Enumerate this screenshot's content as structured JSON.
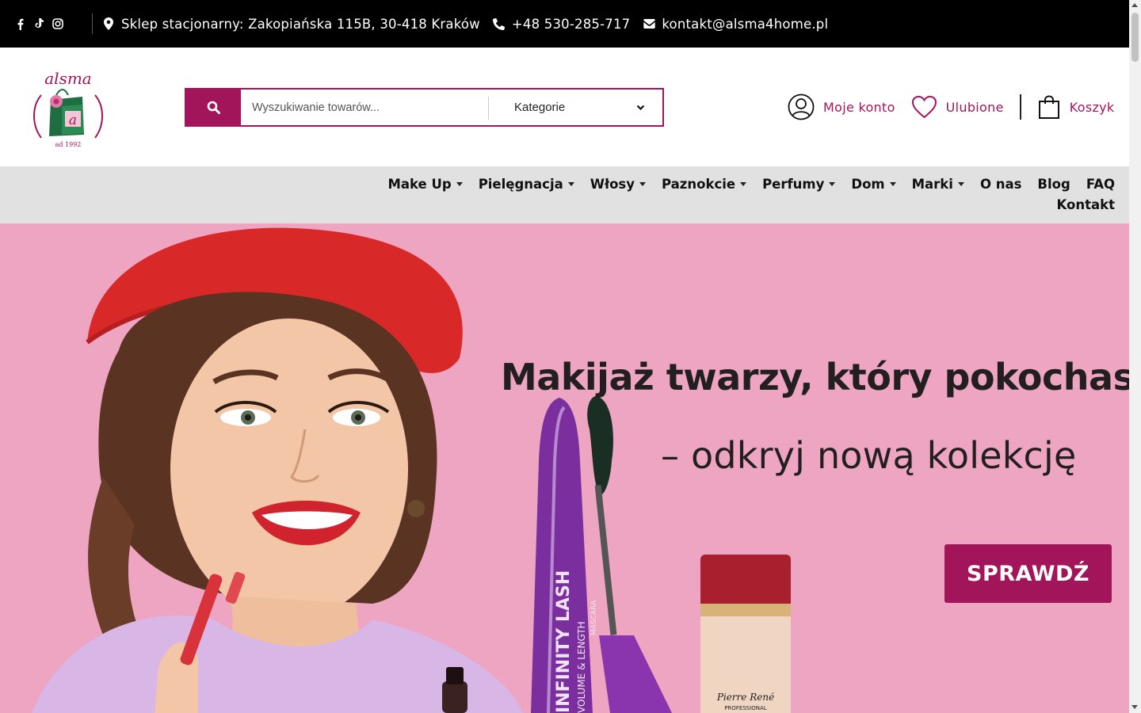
{
  "topbar": {
    "social": [
      {
        "name": "facebook-icon"
      },
      {
        "name": "tiktok-icon"
      },
      {
        "name": "instagram-icon"
      }
    ],
    "address": "Sklep stacjonarny: Zakopiańska 115B, 30-418 Kraków",
    "phone": "+48 530-285-717",
    "email": "kontakt@alsma4home.pl"
  },
  "logo": {
    "name": "alsma",
    "tagline": "ad 1992",
    "letter": "a",
    "colors": {
      "brand": "#a3155a",
      "bag": "#1f6e43"
    }
  },
  "search": {
    "placeholder": "Wyszukiwanie towarów...",
    "category_label": "Kategorie"
  },
  "header_actions": {
    "account": "Moje konto",
    "favorites": "Ulubione",
    "cart": "Koszyk"
  },
  "nav": {
    "items": [
      {
        "label": "Make Up",
        "dropdown": true
      },
      {
        "label": "Pielęgnacja",
        "dropdown": true
      },
      {
        "label": "Włosy",
        "dropdown": true
      },
      {
        "label": "Paznokcie",
        "dropdown": true
      },
      {
        "label": "Perfumy",
        "dropdown": true
      },
      {
        "label": "Dom",
        "dropdown": true
      },
      {
        "label": "Marki",
        "dropdown": true
      },
      {
        "label": "O nas",
        "dropdown": false
      },
      {
        "label": "Blog",
        "dropdown": false
      },
      {
        "label": "FAQ",
        "dropdown": false
      }
    ],
    "second_row": [
      {
        "label": "Kontakt",
        "dropdown": false
      }
    ]
  },
  "hero": {
    "headline": "Makijaż twarzy, który pokochasz",
    "subheadline": "– odkryj nową kolekcję",
    "cta": "SPRAWDŹ",
    "mascara_label_1": "INFINITY LASH",
    "mascara_label_2": "VOLUME & LENGTH",
    "mascara_label_3": "MASCARA",
    "foundation_brand": "Pierre René",
    "foundation_sub": "PROFESSIONAL",
    "colors": {
      "background": "#eea5c2",
      "accent": "#a3155a"
    }
  }
}
